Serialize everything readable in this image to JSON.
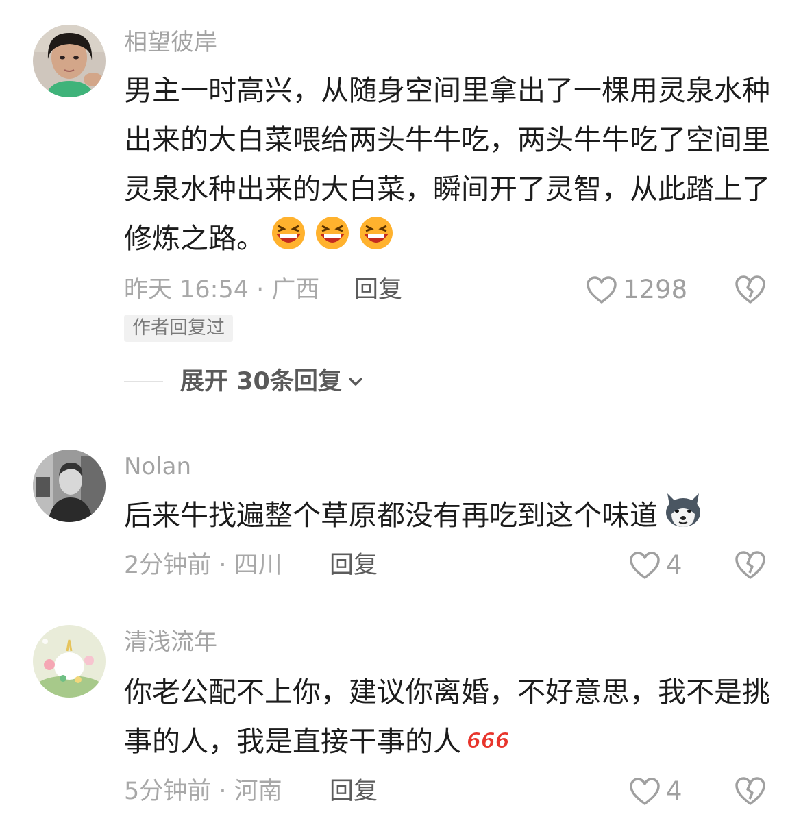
{
  "comments": [
    {
      "username": "相望彼岸",
      "content": "男主一时高兴，从随身空间里拿出了一棵用灵泉水种出来的大白菜喂给两头牛牛吃，两头牛牛吃了空间里灵泉水种出来的大白菜，瞬间开了灵智，从此踏上了修炼之路。",
      "emoji": [
        "laughing-face",
        "laughing-face",
        "laughing-face"
      ],
      "time_location": "昨天 16:54 · 广西",
      "reply_label": "回复",
      "likes": "1298",
      "author_badge": "作者回复过",
      "expand_label": "展开 30条回复"
    },
    {
      "username": "Nolan",
      "content": "后来牛找遍整个草原都没有再吃到这个味道",
      "emoji": [
        "husky-dog"
      ],
      "time_location": "2分钟前 · 四川",
      "reply_label": "回复",
      "likes": "4"
    },
    {
      "username": "清浅流年",
      "content": "你老公配不上你，建议你离婚，不好意思，我不是挑事的人，我是直接干事的人",
      "emoji": [
        "666-badge"
      ],
      "time_location": "5分钟前 · 河南",
      "reply_label": "回复",
      "likes": "4"
    }
  ],
  "colors": {
    "text": "#1c1c1c",
    "muted": "#a3a3a3",
    "badge_bg": "#f1f1f1",
    "emoji_red": "#e8352c"
  }
}
